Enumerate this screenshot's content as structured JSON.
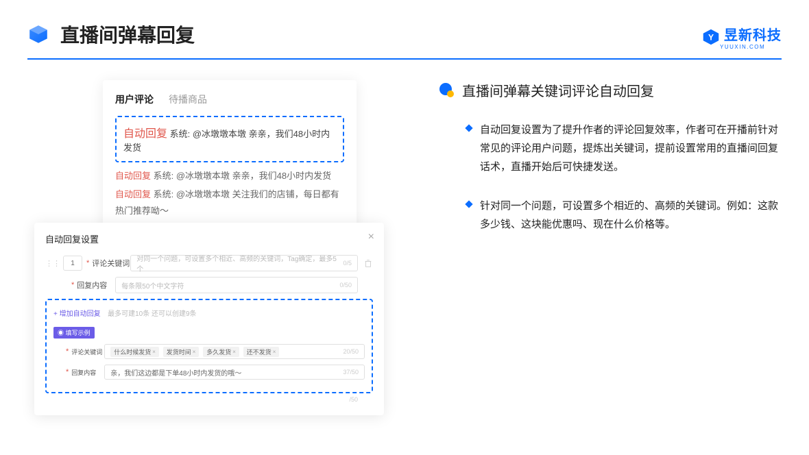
{
  "header": {
    "title": "直播间弹幕回复",
    "brand_zh": "昱新科技",
    "brand_en": "YUUXIN.COM"
  },
  "comment_panel": {
    "tabs": {
      "active": "用户评论",
      "inactive": "待播商品"
    },
    "highlighted": {
      "tag": "自动回复",
      "text": " 系统: @冰墩墩本墩 亲亲，我们48小时内发货"
    },
    "lines": [
      {
        "tag": "自动回复",
        "text": " 系统: @冰墩墩本墩 亲亲，我们48小时内发货"
      },
      {
        "tag": "自动回复",
        "text": " 系统: @冰墩墩本墩 关注我们的店铺，每日都有热门推荐呦～"
      }
    ]
  },
  "settings": {
    "title": "自动回复设置",
    "num": "1",
    "kw_label": "评论关键词",
    "kw_placeholder": "对同一个问题，可设置多个相近、高频的关键词，Tag确定，最多5个",
    "kw_count": "0/5",
    "content_label": "回复内容",
    "content_placeholder": "每条限50个中文字符",
    "content_count": "0/50",
    "add_link": "+ 增加自动回复",
    "add_hint": "最多可建10条 还可以创建9条",
    "example_badge": "◉ 填写示例",
    "ex_kw_label": "评论关键词",
    "ex_tags": [
      "什么时候发货",
      "发货时间",
      "多久发货",
      "还不发货"
    ],
    "ex_kw_count": "20/50",
    "ex_content_label": "回复内容",
    "ex_content_text": "亲，我们这边都是下单48小时内发货的哦～",
    "ex_content_count": "37/50",
    "outer_count": "/50"
  },
  "section": {
    "title": "直播间弹幕关键词评论自动回复",
    "bullets": [
      "自动回复设置为了提升作者的评论回复效率，作者可在开播前针对常见的评论用户问题，提炼出关键词，提前设置常用的直播间回复话术，直播开始后可快捷发送。",
      "针对同一个问题，可设置多个相近的、高频的关键词。例如：这款多少钱、这块能优惠吗、现在什么价格等。"
    ]
  }
}
